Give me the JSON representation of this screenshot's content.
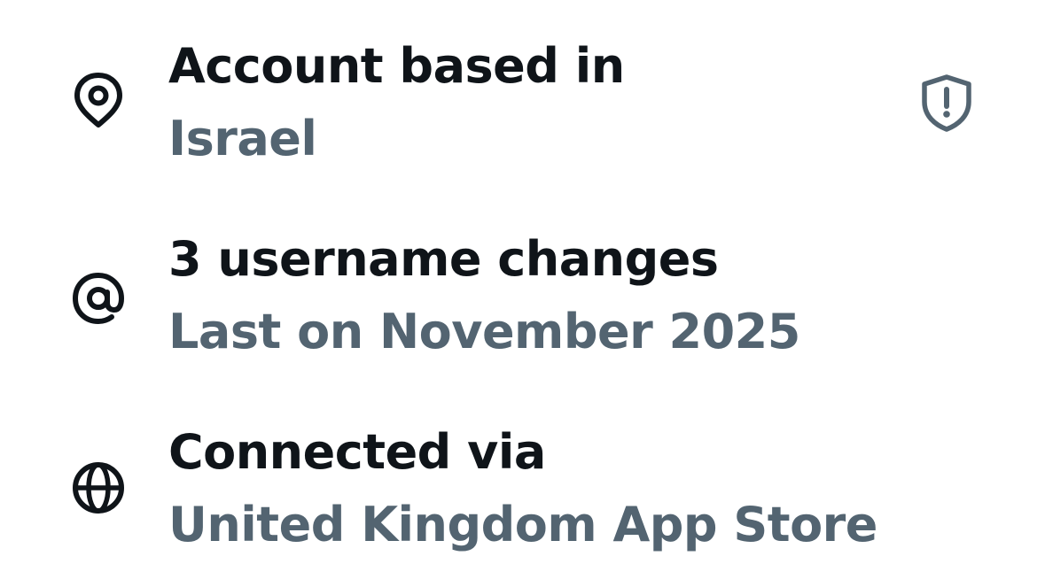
{
  "rows": [
    {
      "icon": "location-pin-icon",
      "title": "Account based in",
      "subtitle": "Israel",
      "trailing_icon": "shield-alert-icon"
    },
    {
      "icon": "at-sign-icon",
      "title": "3 username changes",
      "subtitle": "Last on November 2025"
    },
    {
      "icon": "globe-icon",
      "title": "Connected via",
      "subtitle": "United Kingdom App Store"
    }
  ],
  "colors": {
    "primary_text": "#0f1419",
    "secondary_text": "#536471",
    "icon": "#0f1419",
    "shield": "#536471",
    "background": "#ffffff"
  }
}
